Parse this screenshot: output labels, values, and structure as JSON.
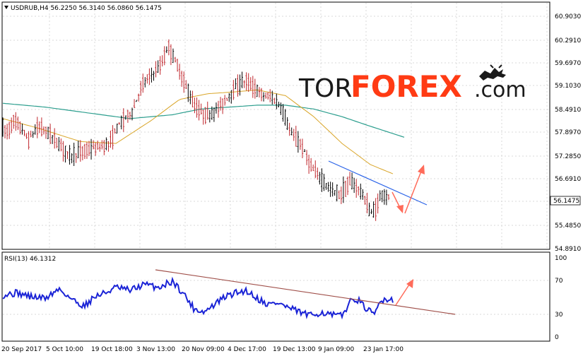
{
  "colors": {
    "bull": "#000000",
    "bear": "#c0272d",
    "ma_fast": "#d9a528",
    "ma_slow": "#2c9e8e",
    "rsi": "#1a23d6",
    "trendline_price": "#2a63e8",
    "trendline_rsi": "#a0504a",
    "arrow": "#ff6b5a",
    "grid": "#d8d8d8",
    "logo_dark": "#1a1a1a",
    "logo_accent": "#ff3b14"
  },
  "price_panel": {
    "title": "USDRUB,H4  56.2250 56.3140 56.0860 56.1475",
    "current_price": "56.1475",
    "y_ticks": [
      "60.9030",
      "60.2910",
      "59.6970",
      "59.1030",
      "58.4910",
      "57.8970",
      "57.2850",
      "56.6910",
      "55.4850",
      "54.8910"
    ]
  },
  "rsi_panel": {
    "title": "RSI(13) 46.1312",
    "y_ticks": [
      "100",
      "70",
      "30",
      "0"
    ]
  },
  "time_axis": {
    "labels": [
      "20 Sep 2017",
      "5 Oct 10:00",
      "19 Oct 18:00",
      "3 Nov 13:00",
      "20 Nov 09:00",
      "4 Dec 17:00",
      "19 Dec 13:00",
      "9 Jan 09:00",
      "23 Jan 17:00"
    ]
  },
  "logo": {
    "part1": "TOR",
    "part2": "FOREX",
    "part3": ".com",
    "icon": "bull-bear-icon"
  },
  "chart_data": {
    "type": "candlestick",
    "symbol": "USDRUB",
    "timeframe": "H4",
    "ylim": [
      54.89,
      61.2
    ],
    "anchors": [
      [
        0,
        58.05
      ],
      [
        10,
        57.9
      ],
      [
        20,
        58.2
      ],
      [
        30,
        58.0
      ],
      [
        40,
        57.7
      ],
      [
        55,
        58.05
      ],
      [
        70,
        57.85
      ],
      [
        85,
        57.55
      ],
      [
        100,
        57.25
      ],
      [
        110,
        57.35
      ],
      [
        125,
        57.45
      ],
      [
        140,
        57.5
      ],
      [
        155,
        57.6
      ],
      [
        165,
        58.0
      ],
      [
        178,
        58.3
      ],
      [
        188,
        58.45
      ],
      [
        200,
        59.1
      ],
      [
        215,
        59.4
      ],
      [
        228,
        59.65
      ],
      [
        238,
        60.15
      ],
      [
        246,
        59.85
      ],
      [
        255,
        59.45
      ],
      [
        265,
        59.0
      ],
      [
        275,
        58.6
      ],
      [
        285,
        58.4
      ],
      [
        298,
        58.35
      ],
      [
        310,
        58.55
      ],
      [
        322,
        58.8
      ],
      [
        335,
        59.1
      ],
      [
        348,
        59.25
      ],
      [
        360,
        59.05
      ],
      [
        372,
        58.85
      ],
      [
        385,
        58.8
      ],
      [
        397,
        58.55
      ],
      [
        406,
        58.15
      ],
      [
        412,
        57.85
      ],
      [
        425,
        57.6
      ],
      [
        440,
        57.0
      ],
      [
        455,
        56.65
      ],
      [
        470,
        56.35
      ],
      [
        482,
        56.25
      ],
      [
        495,
        56.6
      ],
      [
        508,
        56.4
      ],
      [
        518,
        56.1
      ],
      [
        524,
        55.75
      ],
      [
        532,
        55.9
      ],
      [
        540,
        56.3
      ],
      [
        548,
        56.2
      ],
      [
        553,
        56.15
      ]
    ],
    "ma_fast_anchors": [
      [
        0,
        58.25
      ],
      [
        50,
        58.0
      ],
      [
        110,
        57.65
      ],
      [
        160,
        57.6
      ],
      [
        210,
        58.2
      ],
      [
        250,
        58.75
      ],
      [
        290,
        58.9
      ],
      [
        330,
        58.95
      ],
      [
        360,
        59.0
      ],
      [
        400,
        58.85
      ],
      [
        440,
        58.3
      ],
      [
        480,
        57.6
      ],
      [
        520,
        57.05
      ],
      [
        553,
        56.8
      ]
    ],
    "ma_slow_anchors": [
      [
        0,
        58.65
      ],
      [
        60,
        58.55
      ],
      [
        120,
        58.4
      ],
      [
        180,
        58.25
      ],
      [
        240,
        58.35
      ],
      [
        280,
        58.5
      ],
      [
        320,
        58.55
      ],
      [
        360,
        58.6
      ],
      [
        400,
        58.6
      ],
      [
        440,
        58.5
      ],
      [
        480,
        58.3
      ],
      [
        520,
        58.05
      ],
      [
        570,
        57.75
      ]
    ],
    "rsi_anchors": [
      [
        0,
        52
      ],
      [
        20,
        55
      ],
      [
        40,
        50
      ],
      [
        60,
        48
      ],
      [
        80,
        60
      ],
      [
        100,
        45
      ],
      [
        115,
        38
      ],
      [
        130,
        50
      ],
      [
        145,
        55
      ],
      [
        160,
        62
      ],
      [
        180,
        58
      ],
      [
        200,
        66
      ],
      [
        220,
        62
      ],
      [
        240,
        70
      ],
      [
        255,
        55
      ],
      [
        270,
        35
      ],
      [
        285,
        30
      ],
      [
        300,
        40
      ],
      [
        315,
        50
      ],
      [
        330,
        55
      ],
      [
        345,
        58
      ],
      [
        360,
        48
      ],
      [
        375,
        40
      ],
      [
        390,
        42
      ],
      [
        405,
        35
      ],
      [
        420,
        30
      ],
      [
        435,
        25
      ],
      [
        450,
        30
      ],
      [
        465,
        26
      ],
      [
        480,
        25
      ],
      [
        490,
        42
      ],
      [
        500,
        48
      ],
      [
        510,
        38
      ],
      [
        520,
        30
      ],
      [
        525,
        25
      ],
      [
        532,
        40
      ],
      [
        540,
        48
      ],
      [
        548,
        46
      ],
      [
        553,
        46
      ]
    ],
    "rsi_ylim": [
      -5,
      105
    ]
  }
}
